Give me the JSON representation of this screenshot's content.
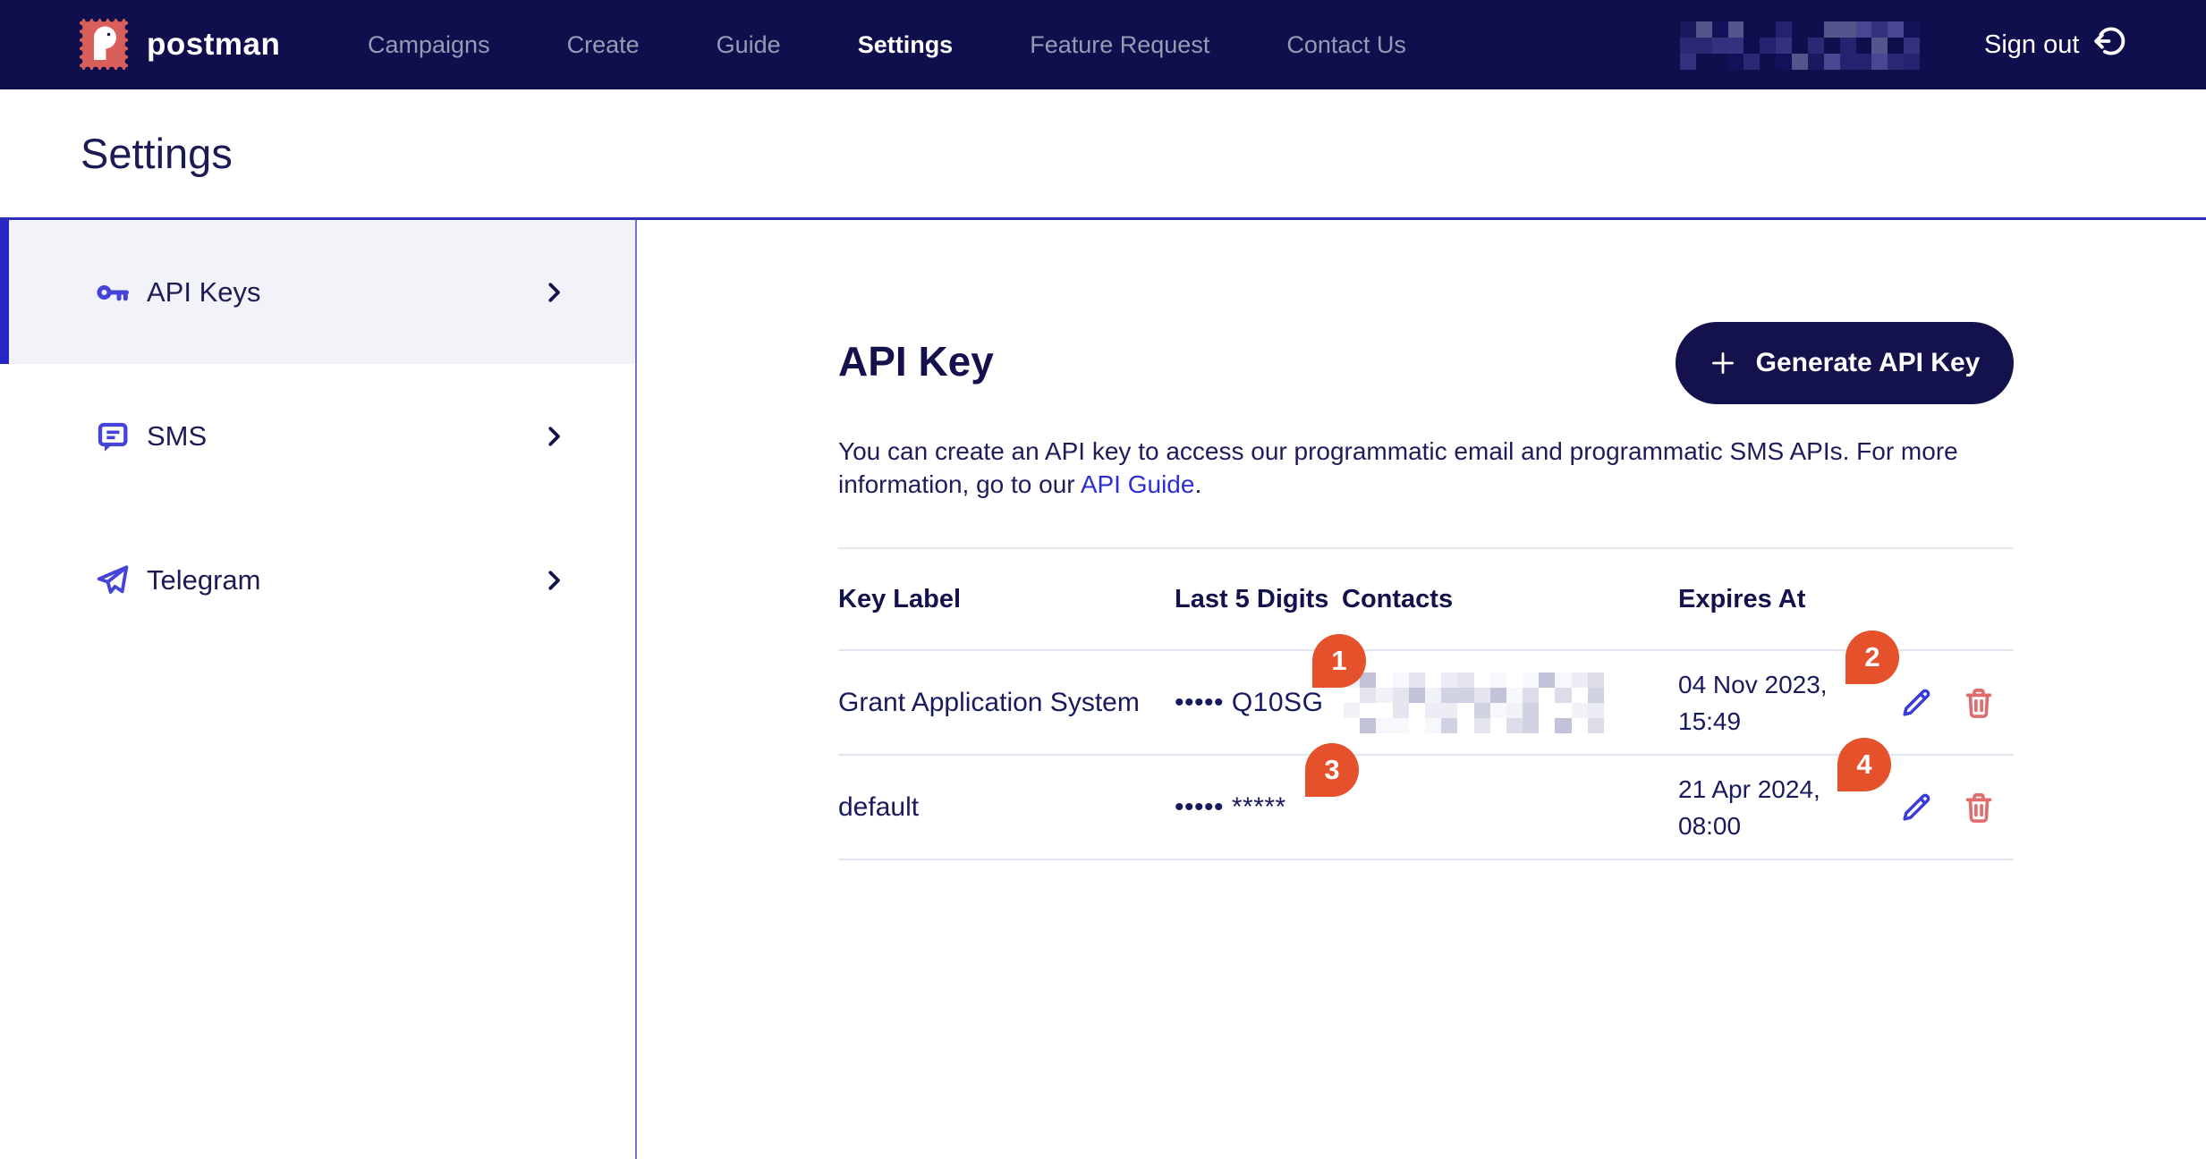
{
  "navbar": {
    "brand": "postman",
    "links": [
      {
        "label": "Campaigns",
        "active": false
      },
      {
        "label": "Create",
        "active": false
      },
      {
        "label": "Guide",
        "active": false
      },
      {
        "label": "Settings",
        "active": true
      },
      {
        "label": "Feature Request",
        "active": false
      },
      {
        "label": "Contact Us",
        "active": false
      }
    ],
    "user_redacted": true,
    "signout": "Sign out"
  },
  "page": {
    "title": "Settings"
  },
  "sidebar": {
    "items": [
      {
        "label": "API Keys",
        "icon": "key-icon",
        "active": true
      },
      {
        "label": "SMS",
        "icon": "sms-icon",
        "active": false
      },
      {
        "label": "Telegram",
        "icon": "telegram-icon",
        "active": false
      }
    ]
  },
  "main": {
    "title": "API Key",
    "generate_button": "Generate API Key",
    "description": {
      "line1": "You can create an API key to access our programmatic email and programmatic SMS APIs. For more",
      "line2_prefix": "information, go to our ",
      "link": "API Guide",
      "suffix": "."
    },
    "table": {
      "headers": [
        "Key Label",
        "Last 5 Digits",
        "Contacts",
        "Expires At"
      ],
      "rows": [
        {
          "key_label": "Grant Application System",
          "last_5_digits": "••••• Q10SG",
          "contacts_redacted": true,
          "expires_at": "04 Nov 2023,\n15:49"
        },
        {
          "key_label": "default",
          "last_5_digits": "••••• *****",
          "contacts_redacted": false,
          "expires_at": "21 Apr 2024,\n08:00"
        }
      ]
    },
    "annotations": [
      {
        "number": "1"
      },
      {
        "number": "2"
      },
      {
        "number": "3"
      },
      {
        "number": "4"
      }
    ]
  },
  "colors": {
    "navbar_bg": "#0f0f4d",
    "accent_indigo": "#4444da",
    "divider_blue": "#2e2eb8",
    "sidebar_active_bg": "#f2f3f9",
    "link_blue": "#2d2dd6",
    "badge_orange": "#e4512b",
    "pencil_blue": "#3a3ad8",
    "trash_red": "#e06c6c",
    "logo_salmon": "#d9605a",
    "button_bg": "#13124d",
    "text_navy": "#181a5e"
  }
}
